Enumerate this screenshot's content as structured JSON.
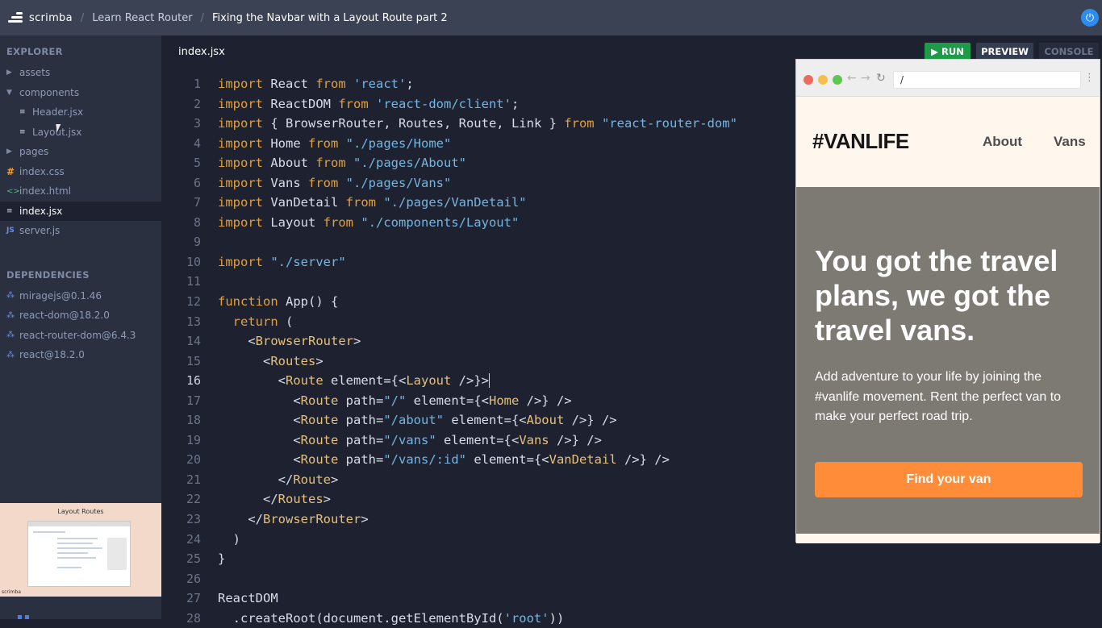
{
  "topbar": {
    "logo_text": "scrimba",
    "breadcrumbs": [
      "Learn React Router",
      "Fixing the Navbar with a Layout Route part 2"
    ],
    "separator": "/"
  },
  "sidebar": {
    "explorer_title": "EXPLORER",
    "files": [
      {
        "label": "assets",
        "icon": "chevron-right-icon"
      },
      {
        "label": "components",
        "icon": "chevron-down-icon"
      },
      {
        "label": "Header.jsx",
        "icon": "none"
      },
      {
        "label": "Layout.jsx",
        "icon": "none"
      },
      {
        "label": "pages",
        "icon": "chevron-right-icon"
      },
      {
        "label": "index.css",
        "icon": "hash-icon"
      },
      {
        "label": "index.html",
        "icon": "code-icon"
      },
      {
        "label": "index.jsx",
        "icon": "lines-icon"
      },
      {
        "label": "server.js",
        "icon": "js-icon"
      }
    ],
    "dependencies_title": "DEPENDENCIES",
    "dependencies": [
      "miragejs@0.1.46",
      "react-dom@18.2.0",
      "react-router-dom@6.4.3",
      "react@18.2.0"
    ],
    "thumbnail_title": "Layout Routes",
    "thumbnail_logo": "scrimba"
  },
  "editor": {
    "file_name": "index.jsx",
    "current_line": 16,
    "line_numbers": [
      "1",
      "2",
      "3",
      "4",
      "5",
      "6",
      "7",
      "8",
      "9",
      "10",
      "11",
      "12",
      "13",
      "14",
      "15",
      "16",
      "17",
      "18",
      "19",
      "20",
      "21",
      "22",
      "23",
      "24",
      "25",
      "26",
      "27",
      "28"
    ]
  },
  "toolbar": {
    "run_label": "RUN",
    "preview_label": "PREVIEW",
    "console_label": "CONSOLE"
  },
  "preview": {
    "url": "/",
    "logo": "#VANLIFE",
    "nav": [
      "About",
      "Vans"
    ],
    "hero_title": "You got the travel plans, we got the travel vans.",
    "hero_subtitle": "Add adventure to your life by joining the #vanlife movement. Rent the perfect van to make your perfect road trip.",
    "hero_button": "Find your van"
  },
  "colors": {
    "run_green": "#1f9a48",
    "accent_orange": "#ff8c38",
    "hero_bg": "#7d7a74",
    "header_bg": "#fff7ed"
  }
}
